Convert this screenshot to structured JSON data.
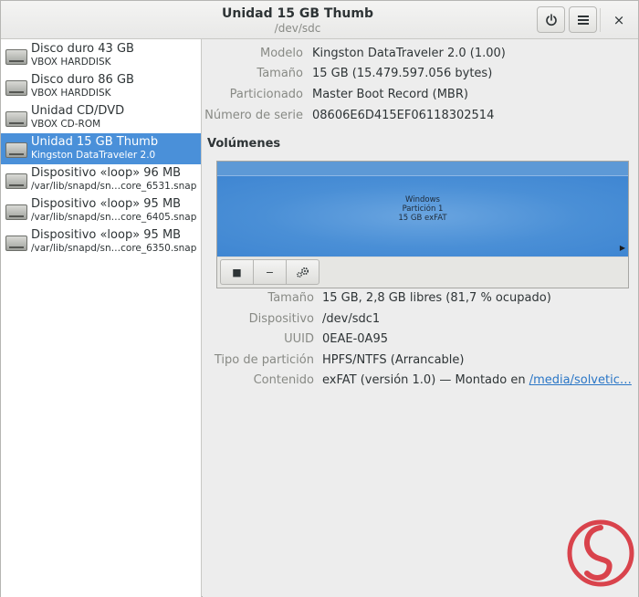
{
  "window": {
    "title": "Unidad 15 GB Thumb",
    "subtitle": "/dev/sdc",
    "power_icon": "power-icon",
    "menu_icon": "hamburger-menu-icon",
    "close_label": "×"
  },
  "sidebar": {
    "items": [
      {
        "name": "Disco duro 43 GB",
        "sub": "VBOX HARDDISK",
        "selected": false
      },
      {
        "name": "Disco duro 86 GB",
        "sub": "VBOX HARDDISK",
        "selected": false
      },
      {
        "name": "Unidad CD/DVD",
        "sub": "VBOX CD-ROM",
        "selected": false
      },
      {
        "name": "Unidad 15 GB Thumb",
        "sub": "Kingston DataTraveler 2.0",
        "selected": true
      },
      {
        "name": "Dispositivo «loop» 96 MB",
        "sub": "/var/lib/snapd/sn…core_6531.snap",
        "selected": false
      },
      {
        "name": "Dispositivo «loop» 95 MB",
        "sub": "/var/lib/snapd/sn…core_6405.snap",
        "selected": false
      },
      {
        "name": "Dispositivo «loop» 95 MB",
        "sub": "/var/lib/snapd/sn…core_6350.snap",
        "selected": false
      }
    ]
  },
  "drive_info": {
    "modelo_label": "Modelo",
    "modelo_value": "Kingston DataTraveler 2.0 (1.00)",
    "tamano_label": "Tamaño",
    "tamano_value": "15 GB (15.479.597.056 bytes)",
    "particionado_label": "Particionado",
    "particionado_value": "Master Boot Record (MBR)",
    "serie_label": "Número de serie",
    "serie_value": "08606E6D415EF06118302514"
  },
  "volumes": {
    "heading": "Volúmenes",
    "partition_line1": "Windows",
    "partition_line2": "Partición 1",
    "partition_line3": "15 GB exFAT",
    "play_glyph": "▶",
    "stop_glyph": "■",
    "minus_glyph": "−"
  },
  "volume_info": {
    "tamano_label": "Tamaño",
    "tamano_value": "15 GB, 2,8 GB libres (81,7 % ocupado)",
    "dispositivo_label": "Dispositivo",
    "dispositivo_value": "/dev/sdc1",
    "uuid_label": "UUID",
    "uuid_value": "0EAE-0A95",
    "tipo_label": "Tipo de partición",
    "tipo_value": "HPFS/NTFS (Arrancable)",
    "contenido_label": "Contenido",
    "contenido_value": "exFAT (versión 1.0) — Montado en ",
    "contenido_link": "/media/solvetic…"
  },
  "colors": {
    "selection": "#4a90d9",
    "arrow": "#f26b6b",
    "watermark": "#d9434c"
  }
}
